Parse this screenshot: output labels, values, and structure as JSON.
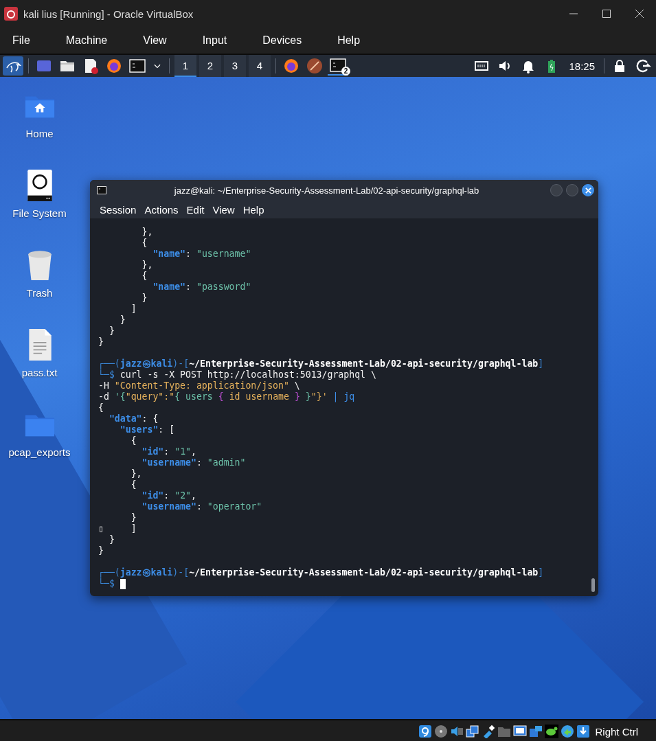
{
  "vbox": {
    "title": "kali lius [Running] - Oracle VirtualBox",
    "menu": [
      "File",
      "Machine",
      "View",
      "Input",
      "Devices",
      "Help"
    ],
    "status_text": "Right Ctrl"
  },
  "panel": {
    "workspaces": [
      {
        "label": "1",
        "selected": true
      },
      {
        "label": "2",
        "selected": false
      },
      {
        "label": "3",
        "selected": false
      },
      {
        "label": "4",
        "selected": false
      }
    ],
    "terminal_badge": "2",
    "clock": "18:25"
  },
  "desktop_icons": [
    {
      "label": "Home",
      "kind": "home"
    },
    {
      "label": "File System",
      "kind": "drive"
    },
    {
      "label": "Trash",
      "kind": "trash"
    },
    {
      "label": "pass.txt",
      "kind": "file"
    },
    {
      "label": "pcap_exports",
      "kind": "folder"
    }
  ],
  "terminal": {
    "title": "jazz@kali: ~/Enterprise-Security-Assessment-Lab/02-api-security/graphql-lab",
    "menu": [
      "Session",
      "Actions",
      "Edit",
      "View",
      "Help"
    ],
    "lines": [
      {
        "segments": [
          {
            "text": "        },",
            "kind": "plain"
          }
        ]
      },
      {
        "segments": [
          {
            "text": "        {",
            "kind": "plain"
          }
        ]
      },
      {
        "segments": [
          {
            "text": "          \"name\"",
            "kind": "key"
          },
          {
            "text": ": ",
            "kind": "plain"
          },
          {
            "text": "\"username\"",
            "kind": "string"
          }
        ]
      },
      {
        "segments": [
          {
            "text": "        },",
            "kind": "plain"
          }
        ]
      },
      {
        "segments": [
          {
            "text": "        {",
            "kind": "plain"
          }
        ]
      },
      {
        "segments": [
          {
            "text": "          \"name\"",
            "kind": "key"
          },
          {
            "text": ": ",
            "kind": "plain"
          },
          {
            "text": "\"password\"",
            "kind": "string"
          }
        ]
      },
      {
        "segments": [
          {
            "text": "        }",
            "kind": "plain"
          }
        ]
      },
      {
        "segments": [
          {
            "text": "      ]",
            "kind": "plain"
          }
        ]
      },
      {
        "segments": [
          {
            "text": "    }",
            "kind": "plain"
          }
        ]
      },
      {
        "segments": [
          {
            "text": "  }",
            "kind": "plain"
          }
        ]
      },
      {
        "segments": [
          {
            "text": "}",
            "kind": "plain"
          }
        ]
      },
      {
        "blank_line_before": true,
        "segments": [
          {
            "text": "┌──(",
            "kind": "frame"
          },
          {
            "text": "jazz㉿kali",
            "kind": "user"
          },
          {
            "text": ")-[",
            "kind": "frame"
          },
          {
            "text": "~/Enterprise-Security-Assessment-Lab/02-api-security/graphql-lab",
            "kind": "path"
          },
          {
            "text": "]",
            "kind": "frame"
          }
        ]
      },
      {
        "segments": [
          {
            "text": "└─$",
            "kind": "frame"
          },
          {
            "text": " curl -s -X POST http://localhost:5013/graphql \\",
            "kind": "plain"
          }
        ]
      },
      {
        "segments": [
          {
            "text": "-H ",
            "kind": "plain"
          },
          {
            "text": "\"Content-Type: application/json\"",
            "kind": "yellow"
          },
          {
            "text": " \\",
            "kind": "plain"
          }
        ]
      },
      {
        "segments": [
          {
            "text": "-d ",
            "kind": "plain"
          },
          {
            "text": "'{",
            "kind": "string"
          },
          {
            "text": "\"query\":\"",
            "kind": "yellow"
          },
          {
            "text": "{ users ",
            "kind": "string"
          },
          {
            "text": "{",
            "kind": "purple"
          },
          {
            "text": " id username ",
            "kind": "yellow"
          },
          {
            "text": "}",
            "kind": "purple"
          },
          {
            "text": " }",
            "kind": "string"
          },
          {
            "text": "\"}'",
            "kind": "yellow"
          },
          {
            "text": " | jq",
            "kind": "blue"
          }
        ]
      },
      {
        "segments": [
          {
            "text": "{",
            "kind": "plain"
          }
        ]
      },
      {
        "segments": [
          {
            "text": "  \"data\"",
            "kind": "key"
          },
          {
            "text": ": {",
            "kind": "plain"
          }
        ]
      },
      {
        "segments": [
          {
            "text": "    \"users\"",
            "kind": "key"
          },
          {
            "text": ": [",
            "kind": "plain"
          }
        ]
      },
      {
        "segments": [
          {
            "text": "      {",
            "kind": "plain"
          }
        ]
      },
      {
        "segments": [
          {
            "text": "        \"id\"",
            "kind": "key"
          },
          {
            "text": ": ",
            "kind": "plain"
          },
          {
            "text": "\"1\"",
            "kind": "string"
          },
          {
            "text": ",",
            "kind": "plain"
          }
        ]
      },
      {
        "segments": [
          {
            "text": "        \"username\"",
            "kind": "key"
          },
          {
            "text": ": ",
            "kind": "plain"
          },
          {
            "text": "\"admin\"",
            "kind": "string"
          }
        ]
      },
      {
        "segments": [
          {
            "text": "      },",
            "kind": "plain"
          }
        ]
      },
      {
        "segments": [
          {
            "text": "      {",
            "kind": "plain"
          }
        ]
      },
      {
        "segments": [
          {
            "text": "        \"id\"",
            "kind": "key"
          },
          {
            "text": ": ",
            "kind": "plain"
          },
          {
            "text": "\"2\"",
            "kind": "string"
          },
          {
            "text": ",",
            "kind": "plain"
          }
        ]
      },
      {
        "segments": [
          {
            "text": "        \"username\"",
            "kind": "key"
          },
          {
            "text": ": ",
            "kind": "plain"
          },
          {
            "text": "\"operator\"",
            "kind": "string"
          }
        ]
      },
      {
        "segments": [
          {
            "text": "      }",
            "kind": "plain"
          }
        ]
      },
      {
        "segments": [
          {
            "text": "▯     ]",
            "kind": "plain"
          }
        ]
      },
      {
        "segments": [
          {
            "text": "  }",
            "kind": "plain"
          }
        ]
      },
      {
        "segments": [
          {
            "text": "}",
            "kind": "plain"
          }
        ]
      },
      {
        "blank_line_before": true,
        "segments": [
          {
            "text": "┌──(",
            "kind": "frame"
          },
          {
            "text": "jazz㉿kali",
            "kind": "user"
          },
          {
            "text": ")-[",
            "kind": "frame"
          },
          {
            "text": "~/Enterprise-Security-Assessment-Lab/02-api-security/graphql-lab",
            "kind": "path"
          },
          {
            "text": "]",
            "kind": "frame"
          }
        ]
      },
      {
        "segments": [
          {
            "text": "└─$",
            "kind": "frame"
          }
        ],
        "cursor": true
      }
    ]
  }
}
